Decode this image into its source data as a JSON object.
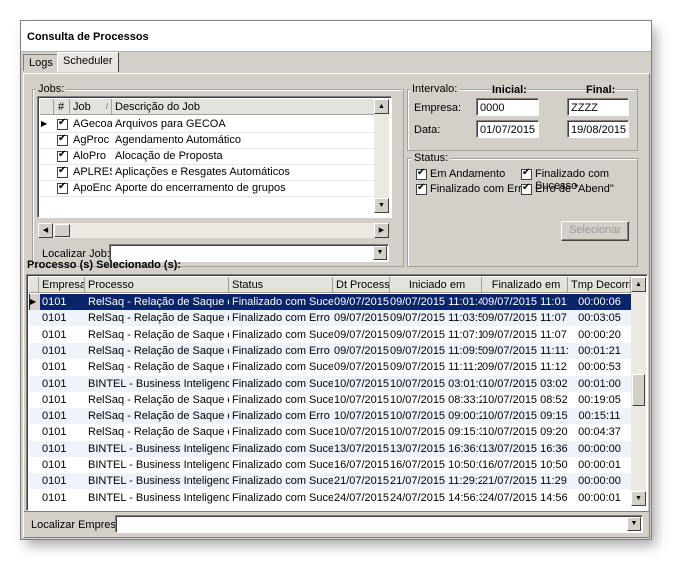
{
  "window": {
    "title": "Consulta de Processos"
  },
  "tabs": [
    {
      "label": "Logs"
    },
    {
      "label": "Scheduler"
    }
  ],
  "jobs": {
    "group_label": "Jobs:",
    "columns": [
      "#",
      "Job",
      "Descrição do Job"
    ],
    "rows": [
      {
        "checked": true,
        "job": "AGecoa",
        "desc": "Arquivos para GECOA"
      },
      {
        "checked": true,
        "job": "AgProc",
        "desc": "Agendamento Automático"
      },
      {
        "checked": true,
        "job": "AloPro",
        "desc": "Alocação de Proposta"
      },
      {
        "checked": true,
        "job": "APLRES",
        "desc": "Aplicações e Resgates Automáticos"
      },
      {
        "checked": true,
        "job": "ApoEnc",
        "desc": "Aporte do encerramento de grupos"
      }
    ],
    "search_label": "Localizar Job:",
    "search_value": ""
  },
  "intervalo": {
    "label": "Intervalo:",
    "inicial_label": "Inicial:",
    "final_label": "Final:",
    "empresa_label": "Empresa:",
    "empresa_inicial": "0000",
    "empresa_final": "ZZZZ",
    "data_label": "Data:",
    "data_inicial": "01/07/2015",
    "data_final": "19/08/2015"
  },
  "status": {
    "label": "Status:",
    "em_andamento": "Em Andamento",
    "finalizado_sucesso": "Finalizado com Sucesso",
    "finalizado_erro": "Finalizado com Erro",
    "erro_abend": "Erro de \"Abend\"",
    "selecionar": "Selecionar"
  },
  "processos": {
    "title": "Processo (s) Selecionado (s):",
    "columns": [
      "Empresa",
      "Processo",
      "Status",
      "Dt Processo",
      "Iniciado em",
      "Finalizado em",
      "Tmp Decorrido"
    ],
    "rows": [
      [
        "0101",
        "RelSaq - Relação de Saque de Seg",
        "Finalizado com Sucesso",
        "09/07/2015",
        "09/07/2015 11:01:48",
        "09/07/2015 11:01:54",
        "00:00:06"
      ],
      [
        "0101",
        "RelSaq - Relação de Saque de Seg",
        "Finalizado com Erro",
        "09/07/2015",
        "09/07/2015 11:03:55",
        "09/07/2015 11:07:00",
        "00:03:05"
      ],
      [
        "0101",
        "RelSaq - Relação de Saque de Seg",
        "Finalizado com Sucesso",
        "09/07/2015",
        "09/07/2015 11:07:13",
        "09/07/2015 11:07:33",
        "00:00:20"
      ],
      [
        "0101",
        "RelSaq - Relação de Saque de Seg",
        "Finalizado com Erro",
        "09/07/2015",
        "09/07/2015 11:09:57",
        "09/07/2015 11:11:18",
        "00:01:21"
      ],
      [
        "0101",
        "RelSaq - Relação de Saque de Seg",
        "Finalizado com Sucesso",
        "09/07/2015",
        "09/07/2015 11:11:25",
        "09/07/2015 11:12:18",
        "00:00:53"
      ],
      [
        "0101",
        "BINTEL - Business Inteligence",
        "Finalizado com Sucesso",
        "10/07/2015",
        "10/07/2015 03:01:02",
        "10/07/2015 03:02:02",
        "00:01:00"
      ],
      [
        "0101",
        "RelSaq - Relação de Saque de Seg",
        "Finalizado com Sucesso",
        "10/07/2015",
        "10/07/2015 08:33:21",
        "10/07/2015 08:52:26",
        "00:19:05"
      ],
      [
        "0101",
        "RelSaq - Relação de Saque de Seg",
        "Finalizado com Erro",
        "10/07/2015",
        "10/07/2015 09:00:20",
        "10/07/2015 09:15:31",
        "00:15:11"
      ],
      [
        "0101",
        "RelSaq - Relação de Saque de Seg",
        "Finalizado com Sucesso",
        "10/07/2015",
        "10/07/2015 09:15:34",
        "10/07/2015 09:20:11",
        "00:04:37"
      ],
      [
        "0101",
        "BINTEL - Business Inteligence",
        "Finalizado com Sucesso",
        "13/07/2015",
        "13/07/2015 16:36:04",
        "13/07/2015 16:36:04",
        "00:00:00"
      ],
      [
        "0101",
        "BINTEL - Business Inteligence",
        "Finalizado com Sucesso",
        "16/07/2015",
        "16/07/2015 10:50:03",
        "16/07/2015 10:50:04",
        "00:00:01"
      ],
      [
        "0101",
        "BINTEL - Business Inteligence",
        "Finalizado com Sucesso",
        "21/07/2015",
        "21/07/2015 11:29:25",
        "21/07/2015 11:29:25",
        "00:00:00"
      ],
      [
        "0101",
        "BINTEL - Business Inteligence",
        "Finalizado com Sucesso",
        "24/07/2015",
        "24/07/2015 14:56:35",
        "24/07/2015 14:56:36",
        "00:00:01"
      ]
    ],
    "search_label": "Localizar Empresa:",
    "search_value": ""
  },
  "colors": {
    "selection": "#0a246a",
    "window_bg": "#d4d0c8",
    "stripe": "#eef3fb"
  }
}
